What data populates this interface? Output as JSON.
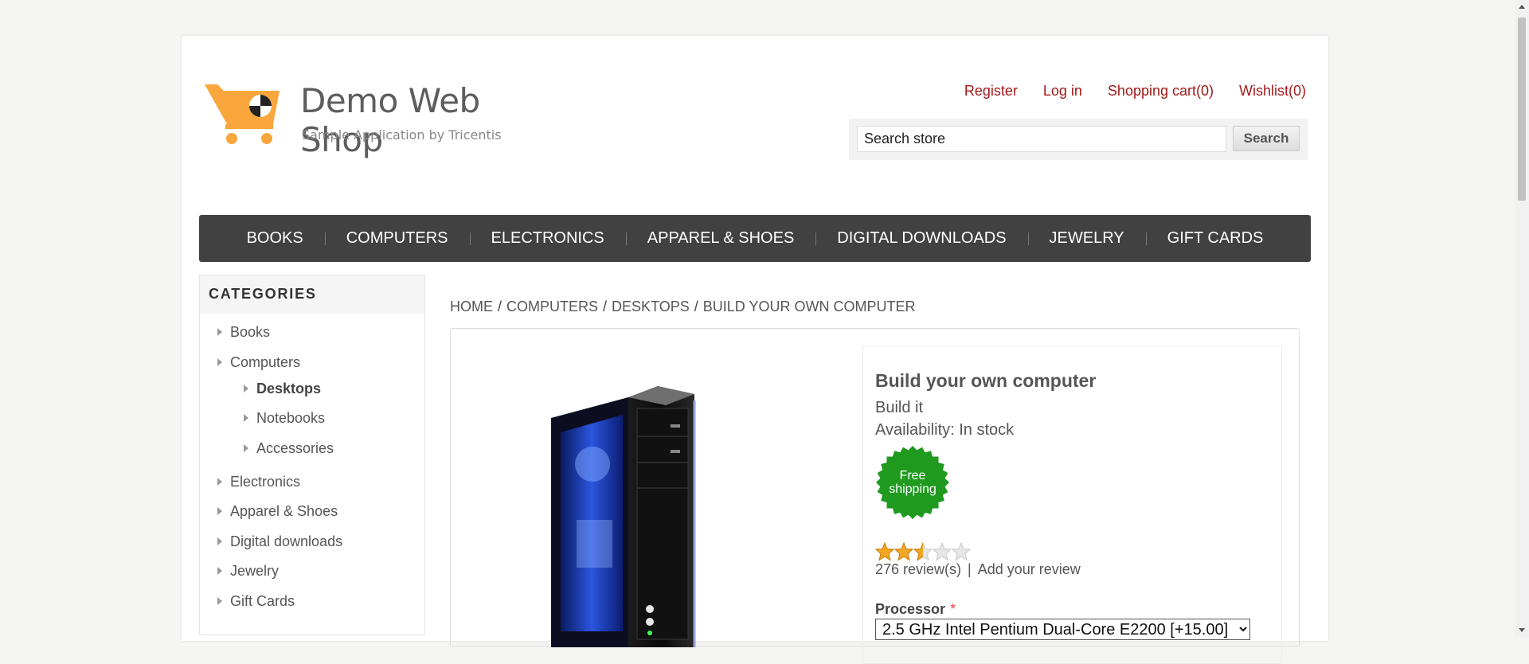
{
  "logo": {
    "title": "Demo Web Shop",
    "subtitle": "Sample Application by Tricentis",
    "icon": "cart-icon",
    "color": "#f9a73d"
  },
  "header": {
    "links": [
      "Register",
      "Log in",
      "Shopping cart(0)",
      "Wishlist(0)"
    ],
    "link_color": "#a31919"
  },
  "search": {
    "value": "Search store",
    "button": "Search"
  },
  "menu": [
    "BOOKS",
    "COMPUTERS",
    "ELECTRONICS",
    "APPAREL & SHOES",
    "DIGITAL DOWNLOADS",
    "JEWELRY",
    "GIFT CARDS"
  ],
  "sidebar": {
    "title": "CATEGORIES",
    "items": [
      "Books",
      "Computers",
      "Desktops",
      "Notebooks",
      "Accessories",
      "Electronics",
      "Apparel & Shoes",
      "Digital downloads",
      "Jewelry",
      "Gift Cards"
    ]
  },
  "breadcrumb": [
    "HOME",
    "COMPUTERS",
    "DESKTOPS",
    "BUILD YOUR OWN COMPUTER"
  ],
  "product": {
    "name": "Build your own computer",
    "short": "Build it",
    "availability_label": "Availability:",
    "availability_value": "In stock",
    "badge": "Free shipping",
    "badge_color": "#1f9a1f",
    "rating": 2.5,
    "rating_max": 5,
    "reviews": "276 review(s)",
    "add_review": "Add your review",
    "processor_label": "Processor",
    "processor_required": "*",
    "processor_value": "2.5 GHz Intel Pentium Dual-Core E2200 [+15.00]"
  }
}
